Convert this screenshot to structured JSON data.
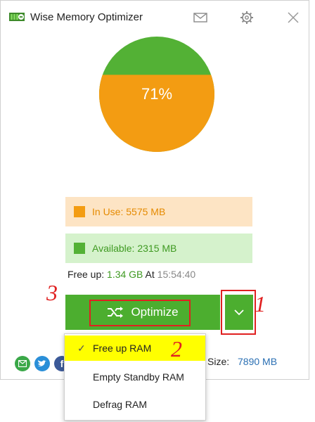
{
  "app": {
    "title": "Wise Memory Optimizer"
  },
  "colors": {
    "accent_green": "#4cae2f",
    "in_use_orange": "#f39c12",
    "available_green": "#53b135",
    "highlight_red": "#e02020"
  },
  "usage": {
    "percent_label": "71%",
    "percent": 71
  },
  "legend": {
    "in_use": "In Use: 5575 MB",
    "available": "Available: 2315 MB"
  },
  "free_up": {
    "label": "Free up:",
    "value": "1.34 GB",
    "at_label": "At",
    "time": "15:54:40"
  },
  "optimize_button": {
    "label": "Optimize"
  },
  "memory_size": {
    "label": "Size:",
    "value": "7890 MB"
  },
  "menu": {
    "items": [
      {
        "label": "Free up RAM",
        "checked": true
      },
      {
        "label": "Empty Standby RAM",
        "checked": false
      },
      {
        "label": "Defrag RAM",
        "checked": false
      }
    ]
  },
  "annotations": {
    "one": "1",
    "two": "2",
    "three": "3"
  },
  "icons": {
    "mail": "mail-icon",
    "settings": "gear-icon",
    "close": "close-icon",
    "dropdown": "chevron-down-icon",
    "shuffle": "shuffle-icon",
    "check": "check-icon"
  }
}
